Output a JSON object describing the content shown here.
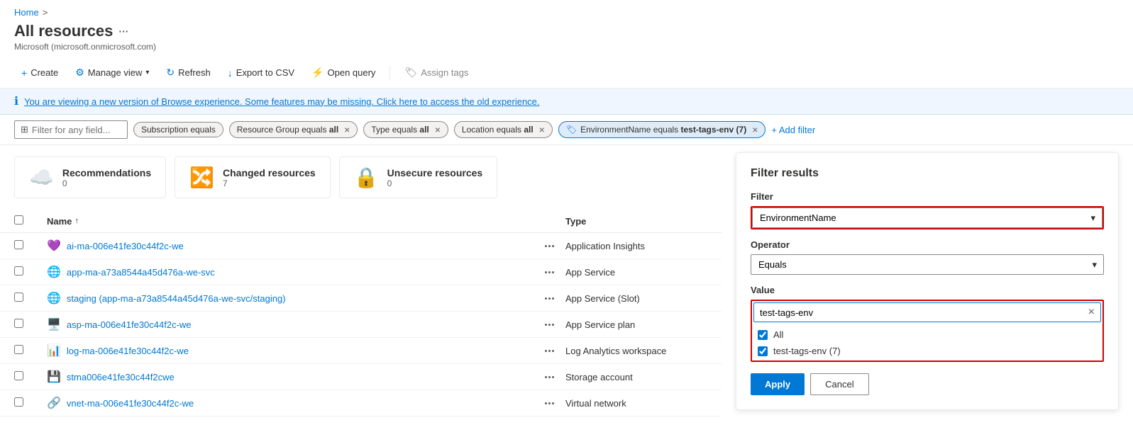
{
  "breadcrumb": {
    "home_label": "Home",
    "separator": ">"
  },
  "page": {
    "title": "All resources",
    "more_icon": "···",
    "subtitle": "Microsoft (microsoft.onmicrosoft.com)"
  },
  "toolbar": {
    "create_label": "Create",
    "manage_view_label": "Manage view",
    "refresh_label": "Refresh",
    "export_label": "Export to CSV",
    "open_query_label": "Open query",
    "assign_tags_label": "Assign tags"
  },
  "info_bar": {
    "message": "You are viewing a new version of Browse experience. Some features may be missing. Click here to access the old experience."
  },
  "filters": {
    "placeholder": "Filter for any field...",
    "tags": [
      {
        "label": "Subscription equals",
        "closable": false
      },
      {
        "label": "Resource Group equals",
        "bold_part": "all",
        "closable": true
      },
      {
        "label": "Type equals",
        "bold_part": "all",
        "closable": true
      },
      {
        "label": "Location equals",
        "bold_part": "all",
        "closable": true
      },
      {
        "label": "EnvironmentName equals",
        "bold_part": "test-tags-env (7)",
        "closable": true,
        "active": true
      }
    ],
    "add_filter_label": "+ Add filter"
  },
  "summary_cards": [
    {
      "title": "Recommendations",
      "count": "0",
      "icon": "☁️"
    },
    {
      "title": "Changed resources",
      "count": "7",
      "icon": "🔀"
    },
    {
      "title": "Unsecure resources",
      "count": "0",
      "icon": "🔒"
    }
  ],
  "table": {
    "col_name": "Name",
    "col_type": "Type",
    "rows": [
      {
        "name": "ai-ma-006e41fe30c44f2c-we",
        "type": "Application Insights",
        "icon": "💜"
      },
      {
        "name": "app-ma-a73a8544a45d476a-we-svc",
        "type": "App Service",
        "icon": "🌐"
      },
      {
        "name": "staging (app-ma-a73a8544a45d476a-we-svc/staging)",
        "type": "App Service (Slot)",
        "icon": "🌐"
      },
      {
        "name": "asp-ma-006e41fe30c44f2c-we",
        "type": "App Service plan",
        "icon": "🖥️"
      },
      {
        "name": "log-ma-006e41fe30c44f2c-we",
        "type": "Log Analytics workspace",
        "icon": "📊"
      },
      {
        "name": "stma006e41fe30c44f2cwe",
        "type": "Storage account",
        "icon": "💾"
      },
      {
        "name": "vnet-ma-006e41fe30c44f2c-we",
        "type": "Virtual network",
        "icon": "🔗"
      }
    ]
  },
  "filter_panel": {
    "title": "Filter results",
    "filter_label": "Filter",
    "filter_value": "EnvironmentName",
    "operator_label": "Operator",
    "operator_value": "Equals",
    "value_label": "Value",
    "value_input": "test-tags-env",
    "checkboxes": [
      {
        "label": "All",
        "checked": true
      },
      {
        "label": "test-tags-env (7)",
        "checked": true
      }
    ],
    "apply_label": "Apply",
    "cancel_label": "Cancel"
  }
}
